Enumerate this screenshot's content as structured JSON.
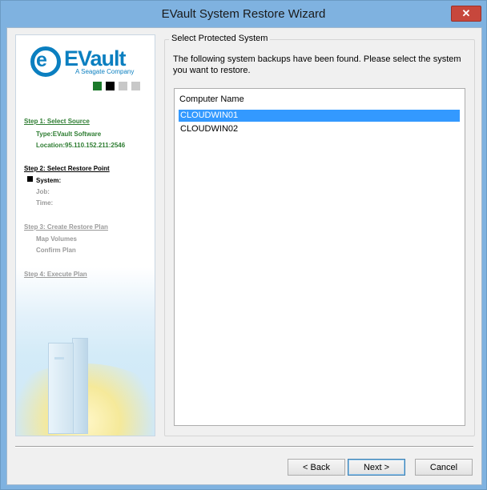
{
  "window": {
    "title": "EVault System Restore Wizard",
    "close_label": "✕"
  },
  "sidebar": {
    "logo": {
      "word": "EVault",
      "e_letter": "e",
      "subtitle": "A Seagate Company"
    },
    "progress_colors": [
      "#1b7a2b",
      "#000000",
      "#c8c8c8",
      "#c8c8c8"
    ],
    "steps": [
      {
        "label": "Step 1: Select Source",
        "state": "done",
        "details": [
          "Type:EVault Software",
          "Location:95.110.152.211:2546"
        ]
      },
      {
        "label": "Step 2: Select Restore Point",
        "state": "current",
        "details": [
          "System:",
          "Job:",
          "Time:"
        ]
      },
      {
        "label": "Step 3: Create Restore Plan",
        "state": "pending",
        "details": [
          "Map Volumes",
          "Confirm Plan"
        ]
      },
      {
        "label": "Step 4: Execute Plan",
        "state": "pending",
        "details": []
      }
    ]
  },
  "main": {
    "group_title": "Select Protected System",
    "instructions": "The following system backups have been found. Please select the system you want to restore.",
    "list": {
      "column_header": "Computer Name",
      "rows": [
        {
          "name": "CLOUDWIN01",
          "selected": true
        },
        {
          "name": "CLOUDWIN02",
          "selected": false
        }
      ]
    }
  },
  "buttons": {
    "back": "< Back",
    "next": "Next >",
    "cancel": "Cancel"
  },
  "colors": {
    "accent_blue": "#0b7fc0",
    "step_done_green": "#2e7d32",
    "selection_blue": "#3399ff",
    "titlebar_blue": "#7fb2e0"
  }
}
